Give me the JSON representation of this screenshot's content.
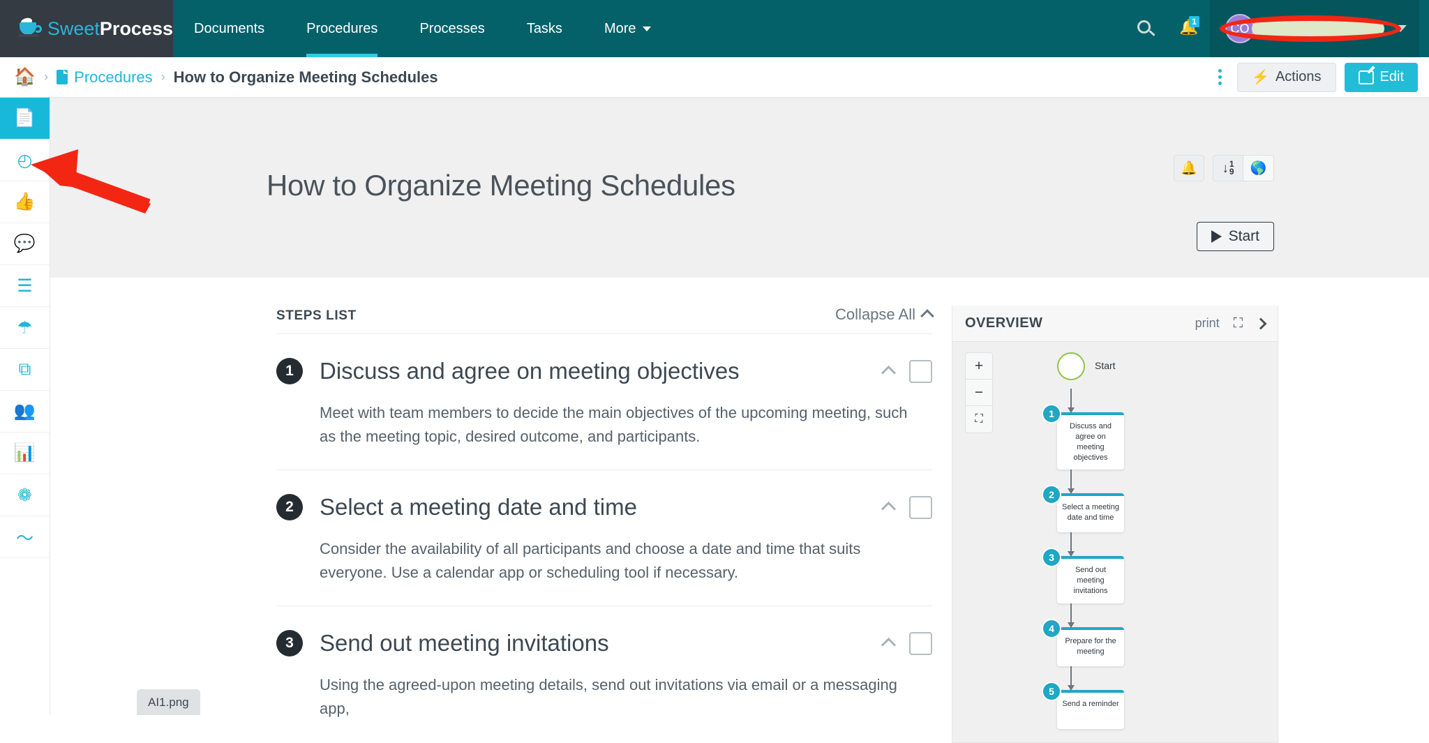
{
  "topnav": {
    "brand": {
      "sweet": "Sweet",
      "process": "Process",
      "logo_icon": "coffee-cup-icon"
    },
    "tabs": [
      {
        "label": "Documents",
        "active": false
      },
      {
        "label": "Procedures",
        "active": true
      },
      {
        "label": "Processes",
        "active": false
      },
      {
        "label": "Tasks",
        "active": false
      },
      {
        "label": "More",
        "active": false,
        "has_caret": true
      }
    ],
    "search_icon": "search-icon",
    "notifications": {
      "icon": "bell-icon",
      "count": "1"
    },
    "user": {
      "initials": "CO",
      "name_redacted": true,
      "chevron": "chevron-down-icon"
    },
    "colors": {
      "nav_bg": "#046169",
      "brand_bg": "#343b43",
      "accent": "#2ecbe6",
      "user_bg": "#04555c"
    }
  },
  "breadcrumb": {
    "home_icon": "home-icon",
    "doc_icon": "document-icon",
    "separator": "›",
    "parent": "Procedures",
    "current": "How to Organize Meeting Schedules",
    "kebab_icon": "more-vertical-icon",
    "actions_label": "Actions",
    "actions_icon": "bolt-icon",
    "edit_label": "Edit",
    "edit_icon": "pencil-square-icon"
  },
  "rail": {
    "items": [
      {
        "name": "document",
        "glyph": "📄",
        "active": true,
        "dark": false
      },
      {
        "name": "history",
        "glyph": "◴",
        "active": false,
        "dark": false
      },
      {
        "name": "approvals",
        "glyph": "👍",
        "active": false,
        "dark": true
      },
      {
        "name": "comments",
        "glyph": "💬",
        "active": false,
        "dark": false
      },
      {
        "name": "checklist",
        "glyph": "☰",
        "active": false,
        "dark": false
      },
      {
        "name": "policies",
        "glyph": "☂",
        "active": false,
        "dark": false
      },
      {
        "name": "duplicate",
        "glyph": "⧉",
        "active": false,
        "dark": false
      },
      {
        "name": "teams",
        "glyph": "👥",
        "active": false,
        "dark": false
      },
      {
        "name": "analytics",
        "glyph": "📊",
        "active": false,
        "dark": false
      },
      {
        "name": "tags",
        "glyph": "❁",
        "active": false,
        "dark": false
      },
      {
        "name": "signature",
        "glyph": "〜",
        "active": false,
        "dark": false
      }
    ]
  },
  "hero": {
    "title": "How to Organize Meeting Schedules",
    "tools": [
      {
        "name": "notify",
        "icon": "bell-icon"
      },
      {
        "name": "sort",
        "icon": "sort-numeric-down-icon",
        "top": "1",
        "bottom": "9"
      },
      {
        "name": "language",
        "icon": "globe-icon"
      }
    ],
    "start_label": "Start",
    "start_icon": "play-icon",
    "bg": "#f0f0f0"
  },
  "steps_panel": {
    "heading": "STEPS LIST",
    "collapse_all_label": "Collapse All",
    "collapse_icon": "chevron-up-icon",
    "steps": [
      {
        "number": "1",
        "title": "Discuss and agree on meeting objectives",
        "body": "Meet with team members to decide the main objectives of the upcoming meeting, such as the meeting topic, desired outcome, and participants."
      },
      {
        "number": "2",
        "title": "Select a meeting date and time",
        "body": "Consider the availability of all participants and choose a date and time that suits everyone. Use a calendar app or scheduling tool if necessary."
      },
      {
        "number": "3",
        "title": "Send out meeting invitations",
        "body": "Using the agreed-upon meeting details, send out invitations via email or a messaging app,"
      }
    ]
  },
  "overview": {
    "title": "OVERVIEW",
    "print_label": "print",
    "expand_icon": "expand-icon",
    "collapse_icon": "chevron-right-icon",
    "zoom_controls": {
      "zoom_in": "+",
      "zoom_out": "−",
      "fit": "⛶"
    },
    "flowchart": {
      "start_label": "Start",
      "nodes": [
        {
          "number": "1",
          "label": "Discuss and agree on meeting objectives"
        },
        {
          "number": "2",
          "label": "Select a meeting date and time"
        },
        {
          "number": "3",
          "label": "Send out meeting invitations"
        },
        {
          "number": "4",
          "label": "Prepare for the meeting"
        },
        {
          "number": "5",
          "label": "Send a reminder"
        }
      ],
      "node_accent": "#1fa7c4",
      "start_ring": "#8cc63f"
    }
  },
  "annotations": {
    "arrow_color": "#f22613",
    "ellipse_color": "#f22613",
    "arrow_target": "sidebar-item-history"
  },
  "download_chip": {
    "filename": "AI1.png"
  }
}
